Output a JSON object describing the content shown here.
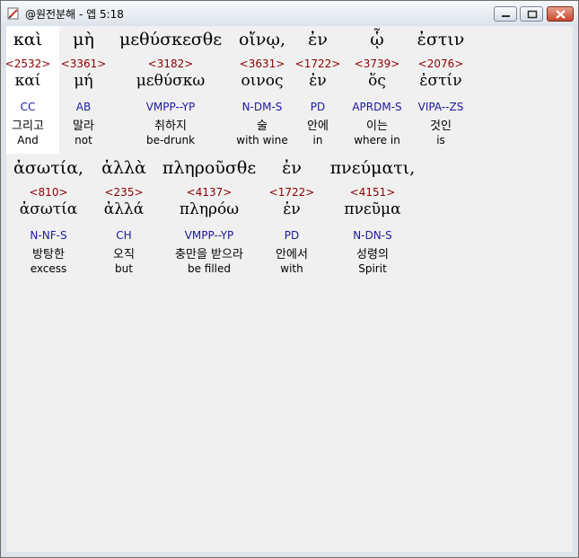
{
  "window": {
    "title": "@원전분해 - 엡 5:18",
    "icons": {
      "app": "bookmark-pen-icon",
      "minimize": "minimize-icon",
      "maximize": "maximize-icon",
      "close": "close-icon"
    },
    "colors": {
      "strong_number": "#8b0000",
      "morph_code": "#1a1aa0",
      "selected_word_bg": "#ffffff"
    }
  },
  "lines": [
    [
      {
        "greek": "καὶ",
        "strong": "<2532>",
        "lemma": "καί",
        "code": "CC",
        "korean": "그리고",
        "english": "And"
      },
      {
        "greek": "μὴ",
        "strong": "<3361>",
        "lemma": "μή",
        "code": "AB",
        "korean": "말라",
        "english": "not"
      },
      {
        "greek": "μεθύσκεσθε",
        "strong": "<3182>",
        "lemma": "μεθύσκω",
        "code": "VMPP--YP",
        "korean": "취하지",
        "english": "be-drunk"
      },
      {
        "greek": "οἴνῳ,",
        "strong": "<3631>",
        "lemma": "οινος",
        "code": "N-DM-S",
        "korean": "술",
        "english": "with wine"
      },
      {
        "greek": "ἐν",
        "strong": "<1722>",
        "lemma": "ἐν",
        "code": "PD",
        "korean": "안에",
        "english": "in"
      },
      {
        "greek": "ᾧ",
        "strong": "<3739>",
        "lemma": "ὅς",
        "code": "APRDM-S",
        "korean": "이는",
        "english": "where in"
      },
      {
        "greek": "ἐστιν",
        "strong": "<2076>",
        "lemma": "ἐστίν",
        "code": "VIPA--ZS",
        "korean": "것인",
        "english": "is"
      }
    ],
    [
      {
        "greek": "ἀσωτία,",
        "strong": "<810>",
        "lemma": "ἀσωτία",
        "code": "N-NF-S",
        "korean": "방탕한",
        "english": "excess"
      },
      {
        "greek": "ἀλλὰ",
        "strong": "<235>",
        "lemma": "ἀλλά",
        "code": "CH",
        "korean": "오직",
        "english": "but"
      },
      {
        "greek": "πληροῦσθε",
        "strong": "<4137>",
        "lemma": "πληρόω",
        "code": "VMPP--YP",
        "korean": "충만을 받으라",
        "english": "be filled"
      },
      {
        "greek": "ἐν",
        "strong": "<1722>",
        "lemma": "ἐν",
        "code": "PD",
        "korean": "안에서",
        "english": "with"
      },
      {
        "greek": "πνεύματι,",
        "strong": "<4151>",
        "lemma": "πνεῦμα",
        "code": "N-DN-S",
        "korean": "성령의",
        "english": "Spirit"
      }
    ]
  ]
}
